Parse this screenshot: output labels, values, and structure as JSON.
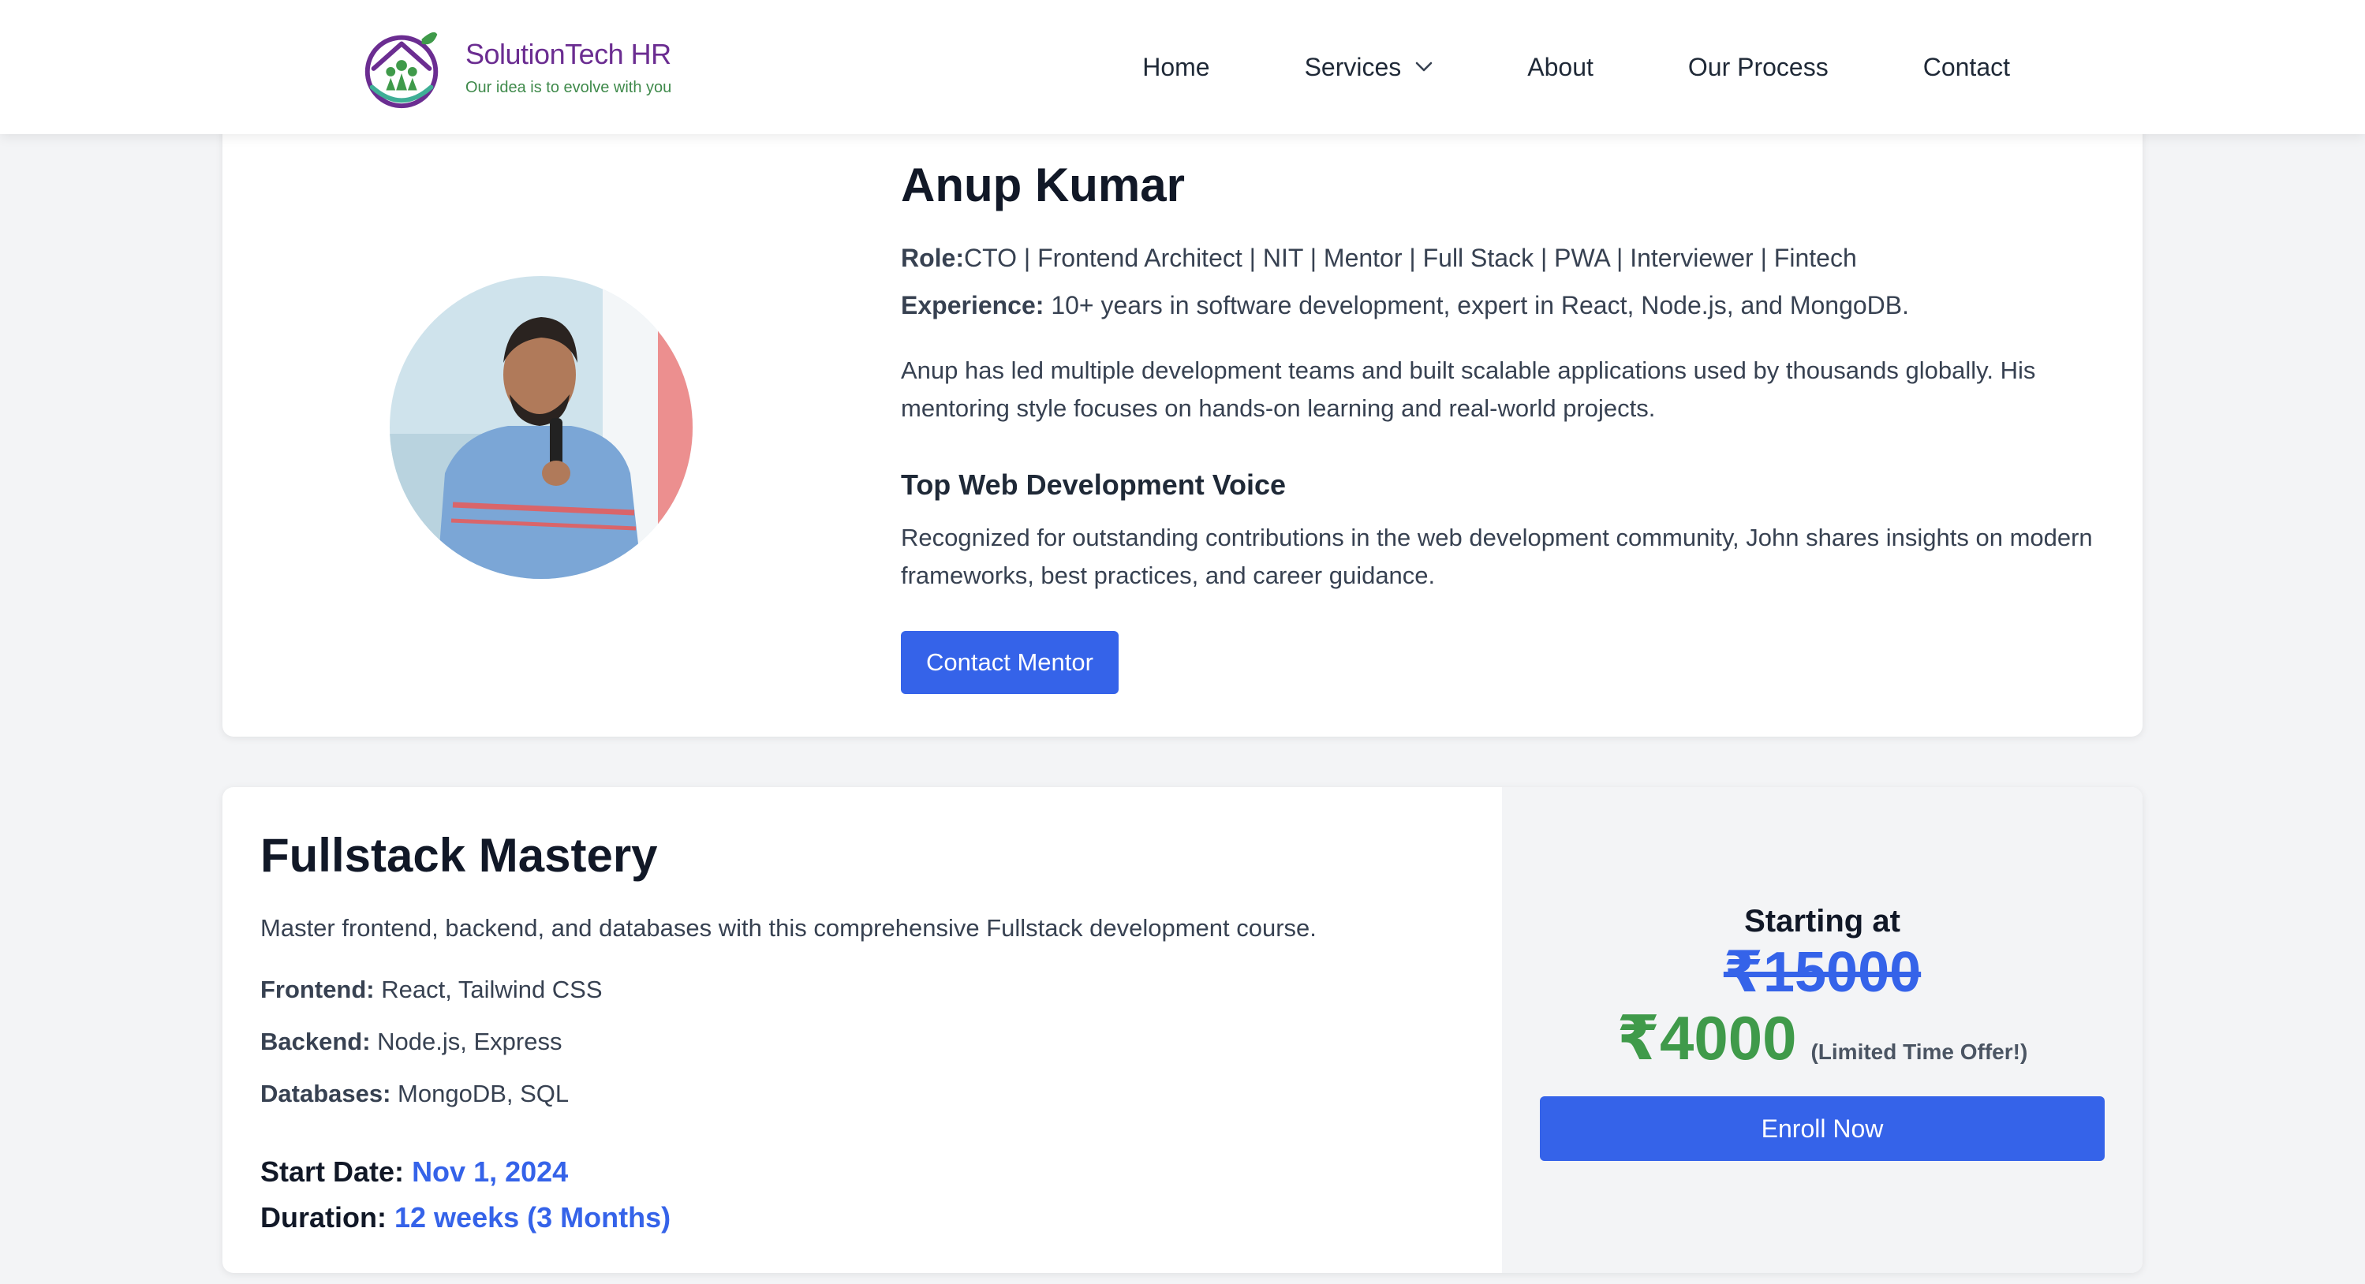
{
  "brand": {
    "name": "SolutionTech HR",
    "tagline": "Our idea is to evolve with you",
    "colors": {
      "primary": "#6b2d91",
      "secondary": "#3f8a4b"
    }
  },
  "nav": {
    "items": [
      {
        "label": "Home"
      },
      {
        "label": "Services",
        "icon": "chevron-down-icon"
      },
      {
        "label": "About"
      },
      {
        "label": "Our Process"
      },
      {
        "label": "Contact"
      }
    ]
  },
  "mentor": {
    "name": "Anup Kumar",
    "role_label": "Role:",
    "role_value": "CTO | Frontend Architect | NIT | Mentor | Full Stack | PWA | Interviewer | Fintech",
    "experience_label": "Experience:",
    "experience_value": "10+ years in software development, expert in React, Node.js, and MongoDB.",
    "bio": "Anup has led multiple development teams and built scalable applications used by thousands globally. His mentoring style focuses on hands-on learning and real-world projects.",
    "award_title": "Top Web Development Voice",
    "award_text": "Recognized for outstanding contributions in the web development community, John shares insights on modern frameworks, best practices, and career guidance.",
    "contact_button": "Contact Mentor"
  },
  "course": {
    "title": "Fullstack Mastery",
    "description": "Master frontend, backend, and databases with this comprehensive Fullstack development course.",
    "specs": [
      {
        "label": "Frontend:",
        "value": "React, Tailwind CSS"
      },
      {
        "label": "Backend:",
        "value": "Node.js, Express"
      },
      {
        "label": "Databases:",
        "value": "MongoDB, SQL"
      }
    ],
    "start_label": "Start Date:",
    "start_value": "Nov 1, 2024",
    "duration_label": "Duration:",
    "duration_value": "12 weeks (3 Months)",
    "price": {
      "starting_label": "Starting at",
      "old_price": "₹15000",
      "new_price": "₹4000",
      "offer_note": "(Limited Time Offer!)",
      "enroll_button": "Enroll Now"
    }
  },
  "colors": {
    "accent": "#3563e9",
    "price_green": "#3f9a4a",
    "page_bg": "#f3f4f6"
  }
}
